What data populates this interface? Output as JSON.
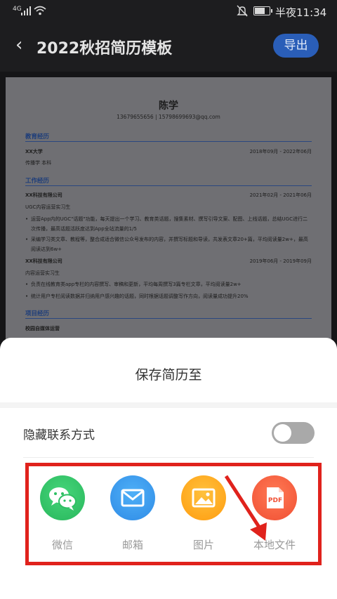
{
  "status_bar": {
    "network": "4G",
    "time": "半夜11:34"
  },
  "header": {
    "title": "2022秋招简历模板",
    "export_label": "导出"
  },
  "resume": {
    "name": "陈学",
    "contact": "13679655656 | 15798699693@qq.com",
    "education": {
      "heading": "教育经历",
      "school": "XX大学",
      "date": "2018年09月 - 2022年06月",
      "detail": "传播学 本科"
    },
    "work": {
      "heading": "工作经历",
      "jobs": [
        {
          "company": "XX科技有限公司",
          "date": "2021年02月 - 2021年06月",
          "role": "UGC内容运营实习生",
          "bullets": [
            "运营App内的UGC\"话题\"功能，每天提出一个学习、教育类话题，搜集素材、撰写引导文案、配图、上线话题，总结UGC进行二次传播，最高话题活跃度达到App全站流量的1/5",
            "采编学习类文章、教程等，整合成适合微信公众号发布的内容，并撰写标题和导读，共发表文章20+篇，平均阅读量2w+，最高阅读达到6w+"
          ]
        },
        {
          "company": "XX科技有限公司",
          "date": "2019年06月 - 2019年09月",
          "role": "内容运营实习生",
          "bullets": [
            "负责在线教育类app专栏的内容撰写、审稿和更新，平均每周撰写3篇专栏文章，平均阅读量2w+",
            "统计用户专栏阅读数据并归纳用户感兴趣的话题，同时根据话题调整写作方向，阅读量成功提升20%"
          ]
        }
      ]
    },
    "project": {
      "heading": "项目经历",
      "first": "校园自媒体运营"
    }
  },
  "sheet": {
    "title": "保存简历至",
    "hide_contact_label": "隐藏联系方式",
    "hide_contact_on": false,
    "targets": [
      {
        "label": "微信",
        "icon": "wechat-icon",
        "color": "#34c46a"
      },
      {
        "label": "邮箱",
        "icon": "mail-icon",
        "color": "#3a9bf0"
      },
      {
        "label": "图片",
        "icon": "image-icon",
        "color": "#ffab1a"
      },
      {
        "label": "本地文件",
        "icon": "pdf-icon",
        "color": "#ff5a3c"
      }
    ]
  },
  "annotation": {
    "highlight_color": "#e0221c"
  }
}
